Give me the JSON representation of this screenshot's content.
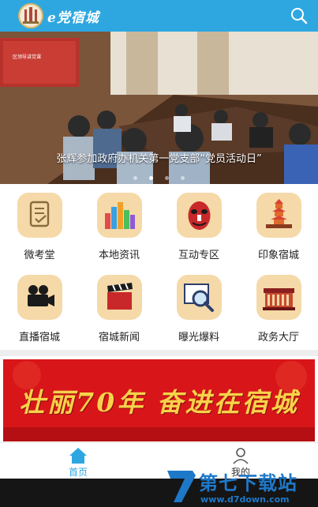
{
  "header": {
    "app_title": "e党宿城",
    "bg_color": "#2ea7e0",
    "search_icon": "search-icon"
  },
  "banner": {
    "caption": "张辉参加政府办机关第一党支部“党员活动日”",
    "slide_count": 4,
    "active_slide": 1,
    "screen_text": "区领导讲党课"
  },
  "grid": {
    "items": [
      {
        "label": "微考堂",
        "icon": "exam-paper-icon"
      },
      {
        "label": "本地资讯",
        "icon": "city-buildings-icon"
      },
      {
        "label": "互动专区",
        "icon": "mask-icon"
      },
      {
        "label": "印象宿城",
        "icon": "pagoda-icon"
      },
      {
        "label": "直播宿城",
        "icon": "video-camera-icon"
      },
      {
        "label": "宿城新闻",
        "icon": "clapperboard-icon"
      },
      {
        "label": "曝光爆料",
        "icon": "magnifier-icon"
      },
      {
        "label": "政务大厅",
        "icon": "government-hall-icon"
      }
    ]
  },
  "promo": {
    "text": "壮丽70年 奋进在宿城",
    "bg_color": "#d8161a"
  },
  "tabbar": {
    "tabs": [
      {
        "label": "首页",
        "icon": "home-icon",
        "active": true
      },
      {
        "label": "我的",
        "icon": "user-icon",
        "active": false
      }
    ],
    "active_color": "#2ea7e0"
  },
  "watermark": {
    "title": "第七下载站",
    "url": "www.d7down.com"
  }
}
